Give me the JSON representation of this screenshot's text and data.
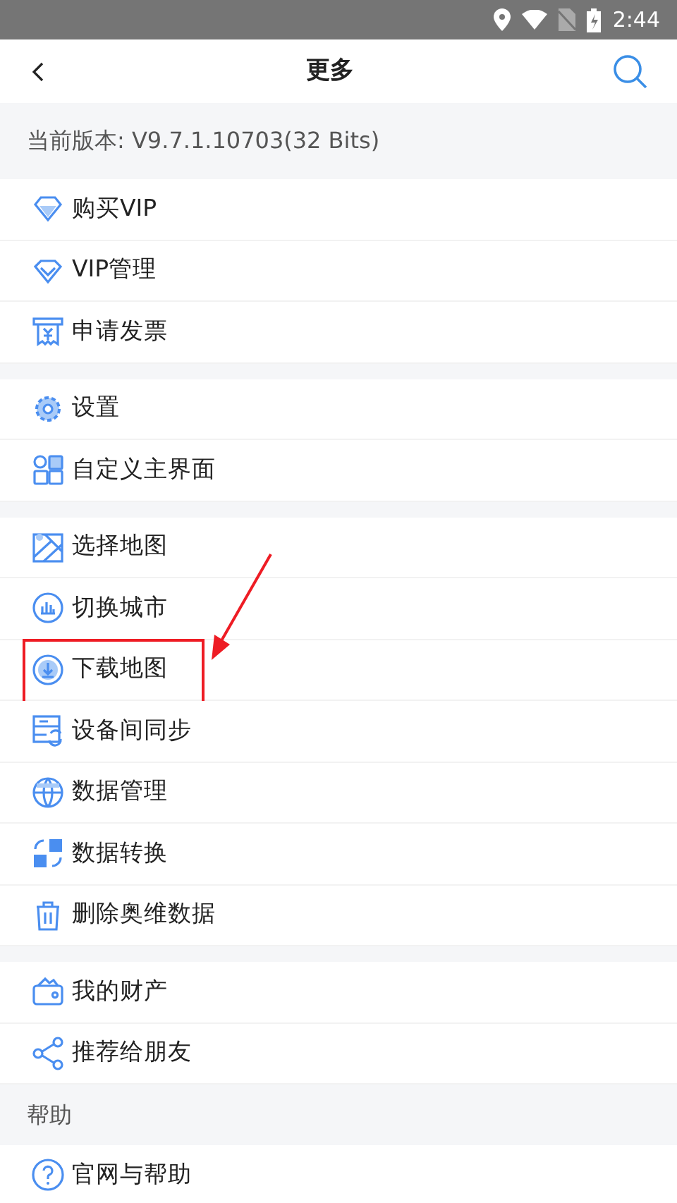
{
  "status_bar": {
    "time": "2:44"
  },
  "header": {
    "title": "更多"
  },
  "version": "当前版本: V9.7.1.10703(32 Bits)",
  "groups": [
    {
      "items": [
        {
          "label": "购买VIP",
          "highlighted": false
        },
        {
          "label": "VIP管理",
          "highlighted": false
        },
        {
          "label": "申请发票",
          "highlighted": false
        }
      ]
    },
    {
      "items": [
        {
          "label": "设置",
          "highlighted": false
        },
        {
          "label": "自定义主界面",
          "highlighted": false
        }
      ]
    },
    {
      "items": [
        {
          "label": "选择地图",
          "highlighted": false
        },
        {
          "label": "切换城市",
          "highlighted": false
        },
        {
          "label": "下载地图",
          "highlighted": true
        },
        {
          "label": "设备间同步",
          "highlighted": false
        },
        {
          "label": "数据管理",
          "highlighted": false
        },
        {
          "label": "数据转换",
          "highlighted": false
        },
        {
          "label": "删除奥维数据",
          "highlighted": false
        }
      ]
    },
    {
      "items": [
        {
          "label": "我的财产",
          "highlighted": false
        },
        {
          "label": "推荐给朋友",
          "highlighted": false
        }
      ]
    },
    {
      "title": "帮助",
      "items": [
        {
          "label": "官网与帮助",
          "highlighted": false
        }
      ]
    }
  ]
}
